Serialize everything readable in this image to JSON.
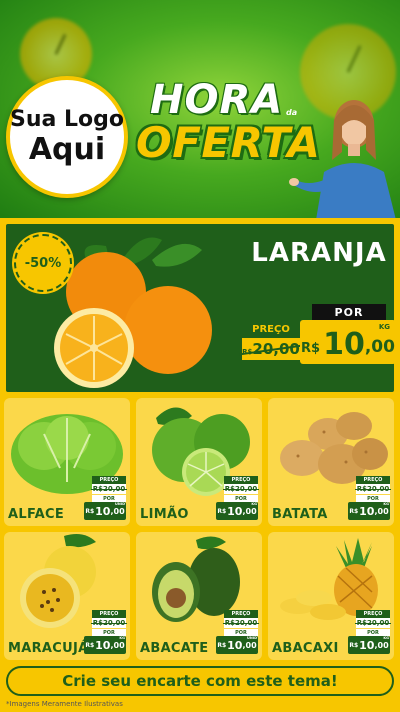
{
  "header": {
    "logo": {
      "line1": "Sua Logo",
      "line2": "Aqui"
    },
    "title_line1": "HORA",
    "title_da": "da",
    "title_line2": "OFERTA"
  },
  "hero": {
    "discount": "-50%",
    "name": "LARANJA",
    "price": {
      "por_label": "POR",
      "preco_label": "PREÇO",
      "old_currency": "R$",
      "old_value": "20,00",
      "currency": "R$",
      "integer": "10",
      "decimal": ",00",
      "unit": "KG"
    }
  },
  "products": [
    {
      "name": "ALFACE",
      "preco_label": "PREÇO",
      "old": "R$20,00",
      "por_label": "POR",
      "currency": "R$",
      "integer": "10",
      "decimal": ",00",
      "unit": "UNID",
      "image": "lettuce"
    },
    {
      "name": "LIMÃO",
      "preco_label": "PREÇO",
      "old": "R$20,00",
      "por_label": "POR",
      "currency": "R$",
      "integer": "10",
      "decimal": ",00",
      "unit": "KG",
      "image": "lime"
    },
    {
      "name": "BATATA",
      "preco_label": "PREÇO",
      "old": "R$20,00",
      "por_label": "POR",
      "currency": "R$",
      "integer": "10",
      "decimal": ",00",
      "unit": "KG",
      "image": "potato"
    },
    {
      "name": "MARACUJÁ",
      "preco_label": "PREÇO",
      "old": "R$20,00",
      "por_label": "POR",
      "currency": "R$",
      "integer": "10",
      "decimal": ",00",
      "unit": "KG",
      "image": "passion-fruit"
    },
    {
      "name": "ABACATE",
      "preco_label": "PREÇO",
      "old": "R$20,00",
      "por_label": "POR",
      "currency": "R$",
      "integer": "10",
      "decimal": ",00",
      "unit": "UNID",
      "image": "avocado"
    },
    {
      "name": "ABACAXI",
      "preco_label": "PREÇO",
      "old": "R$20,00",
      "por_label": "POR",
      "currency": "R$",
      "integer": "10",
      "decimal": ",00",
      "unit": "KG",
      "image": "pineapple"
    }
  ],
  "cta": "Crie seu encarte com este tema!",
  "footnote": "*Imagens Meramente Ilustrativas",
  "colors": {
    "primary_green": "#1f5f1a",
    "accent_yellow": "#f7c600",
    "background_green": "#47a91f"
  }
}
